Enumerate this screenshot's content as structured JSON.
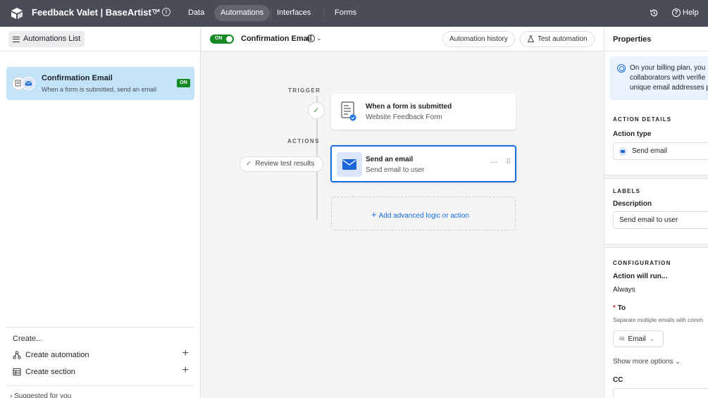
{
  "topbar": {
    "app_title": "Feedback Valet | BaseArtist™",
    "nav": [
      "Data",
      "Automations",
      "Interfaces",
      "Forms"
    ],
    "active_nav": "Automations",
    "help_label": "Help"
  },
  "sidebar": {
    "header_label": "Automations List",
    "automation": {
      "name": "Confirmation Email",
      "description": "When a form is submitted, send an email",
      "status": "ON"
    },
    "create_label": "Create...",
    "create_items": [
      "Create automation",
      "Create section"
    ],
    "suggested_label": "Suggested for you"
  },
  "toolbar": {
    "toggle_label": "ON",
    "automation_title": "Confirmation Email",
    "history_button": "Automation history",
    "test_button": "Test automation"
  },
  "canvas": {
    "trigger_label": "TRIGGER",
    "actions_label": "ACTIONS",
    "trigger_card": {
      "title": "When a form is submitted",
      "subtitle": "Website Feedback Form"
    },
    "action_card": {
      "title": "Send an email",
      "subtitle": "Send email to user",
      "more": "···",
      "drag": "⠿"
    },
    "review_button": "Review test results",
    "add_action": "Add advanced logic or action"
  },
  "properties": {
    "title": "Properties",
    "info_lines": [
      "On your billing plan, you",
      "collaborators with verifie",
      "unique email addresses p"
    ],
    "action_details_label": "ACTION DETAILS",
    "action_type_label": "Action type",
    "action_type_value": "Send email",
    "labels_label": "LABELS",
    "description_label": "Description",
    "description_value": "Send email to user",
    "configuration_label": "CONFIGURATION",
    "action_will_run_label": "Action will run...",
    "action_will_run_value": "Always",
    "to_required": "*",
    "to_label": "To",
    "to_hint": "Separate multiple emails with comm",
    "to_chip": "Email",
    "show_more": "Show more options",
    "cc_label": "CC"
  },
  "colors": {
    "topbar": "#4a4d57",
    "accent_blue": "#166ee1",
    "on_green": "#138a23",
    "selected_item": "#c3e4f8"
  }
}
